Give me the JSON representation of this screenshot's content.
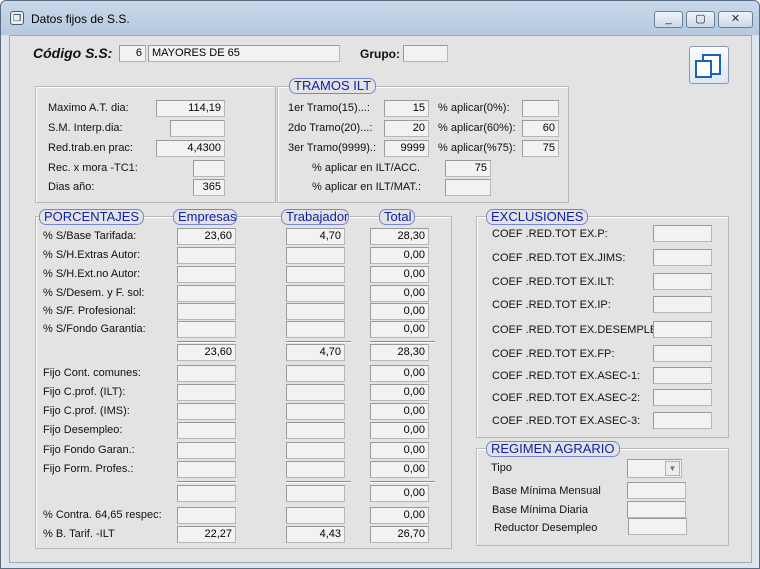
{
  "window": {
    "title": "Datos fijos de S.S.",
    "icon": "doc-icon",
    "minimize_label": "▭",
    "maximize_label": "▢",
    "close_label": "✕"
  },
  "header": {
    "codigo_label": "Código S.S:",
    "codigo_value": "6",
    "codigo_desc": "MAYORES DE 65",
    "grupo_label": "Grupo:",
    "grupo_value": ""
  },
  "left_box": {
    "rows": [
      {
        "label": "Maximo A.T. dia:",
        "value": "114,19"
      },
      {
        "label": "S.M. Interp.dia:",
        "value": ""
      },
      {
        "label": "Red.trab.en prac:",
        "value": "4,4300"
      },
      {
        "label": "Rec. x mora -TC1:",
        "value": ""
      },
      {
        "label": "Dias año:",
        "value": "365"
      }
    ]
  },
  "tramos": {
    "title": "TRAMOS ILT",
    "rows": [
      {
        "label": "1er Tramo(15)...:",
        "value": "15",
        "pct_label": "% aplicar(0%):",
        "pct_value": ""
      },
      {
        "label": "2do Tramo(20)...:",
        "value": "20",
        "pct_label": "% aplicar(60%):",
        "pct_value": "60"
      },
      {
        "label": "3er Tramo(9999).:",
        "value": "9999",
        "pct_label": "% aplicar(%75):",
        "pct_value": "75"
      }
    ],
    "acc_label": "% aplicar en ILT/ACC.",
    "acc_value": "75",
    "mat_label": "% aplicar en ILT/MAT.:",
    "mat_value": ""
  },
  "porcentajes": {
    "title": "PORCENTAJES",
    "col_empresas": "Empresas",
    "col_trabajador": "Trabajador",
    "col_total": "Total",
    "rows": [
      {
        "label": "% S/Base Tarifada:",
        "empresas": "23,60",
        "trabajador": "4,70",
        "total": "28,30"
      },
      {
        "label": "% S/H.Extras Autor:",
        "empresas": "",
        "trabajador": "",
        "total": "0,00"
      },
      {
        "label": "% S/H.Ext.no Autor:",
        "empresas": "",
        "trabajador": "",
        "total": "0,00"
      },
      {
        "label": "% S/Desem. y F. sol:",
        "empresas": "",
        "trabajador": "",
        "total": "0,00"
      },
      {
        "label": "% S/F. Profesional:",
        "empresas": "",
        "trabajador": "",
        "total": "0,00"
      },
      {
        "label": "% S/Fondo Garantia:",
        "empresas": "",
        "trabajador": "",
        "total": "0,00"
      }
    ],
    "subtotal": {
      "empresas": "23,60",
      "trabajador": "4,70",
      "total": "28,30"
    },
    "fijo_rows": [
      {
        "label": "Fijo Cont. comunes:",
        "empresas": "",
        "trabajador": "",
        "total": "0,00"
      },
      {
        "label": "Fijo    C.prof. (ILT):",
        "empresas": "",
        "trabajador": "",
        "total": "0,00"
      },
      {
        "label": "Fijo   C.prof. (IMS):",
        "empresas": "",
        "trabajador": "",
        "total": "0,00"
      },
      {
        "label": "Fijo  Desempleo:",
        "empresas": "",
        "trabajador": "",
        "total": "0,00"
      },
      {
        "label": "Fijo  Fondo Garan.:",
        "empresas": "",
        "trabajador": "",
        "total": "0,00"
      },
      {
        "label": "Fijo Form. Profes.:",
        "empresas": "",
        "trabajador": "",
        "total": "0,00"
      }
    ],
    "subtotal2": {
      "empresas": "",
      "trabajador": "",
      "total": "0,00"
    },
    "contra_label": "% Contra. 64,65 respec:",
    "contra_empresas": "",
    "contra_trabajador": "",
    "contra_total": "0,00",
    "btarif_label": "% B. Tarif. -ILT",
    "btarif_empresas": "22,27",
    "btarif_trabajador": "4,43",
    "btarif_total": "26,70"
  },
  "exclusiones": {
    "title": "EXCLUSIONES",
    "rows": [
      {
        "label": "COEF .RED.TOT EX.P:",
        "value": ""
      },
      {
        "label": "COEF .RED.TOT EX.JIMS:",
        "value": ""
      },
      {
        "label": "COEF .RED.TOT EX.ILT:",
        "value": ""
      },
      {
        "label": "COEF .RED.TOT EX.IP:",
        "value": ""
      },
      {
        "label": "COEF .RED.TOT EX.DESEMPLEO:",
        "value": ""
      },
      {
        "label": "COEF .RED.TOT EX.FP:",
        "value": ""
      },
      {
        "label": "COEF .RED.TOT EX.ASEC-1:",
        "value": ""
      },
      {
        "label": "COEF .RED.TOT EX.ASEC-2:",
        "value": ""
      },
      {
        "label": "COEF .RED.TOT EX.ASEC-3:",
        "value": ""
      }
    ]
  },
  "regimen": {
    "title": "REGIMEN AGRARIO",
    "tipo_label": "Tipo",
    "tipo_value": "",
    "base_mensual_label": "Base Mínima Mensual",
    "base_mensual_value": "",
    "base_diaria_label": "Base Mínima Diaria",
    "base_diaria_value": "",
    "reductor_label": "Reductor Desempleo",
    "reductor_value": ""
  }
}
